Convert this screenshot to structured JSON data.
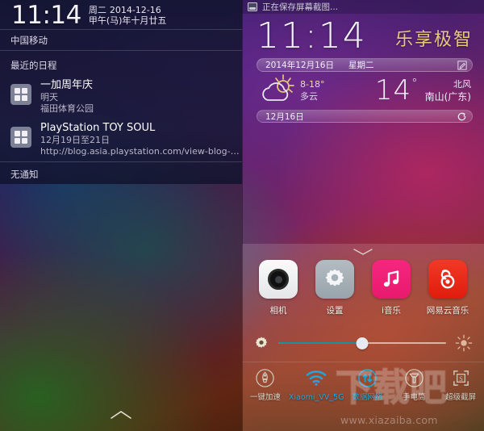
{
  "left_panel": {
    "clock": {
      "time": "11:14",
      "weekday": "周二",
      "date_iso": "2014-12-16",
      "lunar": "甲午(马)年十月廿五"
    },
    "carrier": "中国移动",
    "section_title": "最近的日程",
    "notifications": [
      {
        "icon": "calendar-grid-icon",
        "title": "一加周年庆",
        "line2": "明天",
        "line3": "福田体育公园"
      },
      {
        "icon": "calendar-grid-icon",
        "title": "PlayStation TOY SOUL",
        "line2": "12月19日至21日",
        "line3": "http://blog.asia.playstation.com/view-blog-…"
      }
    ],
    "empty_text": "无通知",
    "home_chevron": "chevron-up-icon"
  },
  "right_panel": {
    "statusbar": {
      "icon": "screenshot-saving-icon",
      "text": "正在保存屏幕截图..."
    },
    "clock_widget": {
      "time": "11:14",
      "slogan": "乐享极智",
      "date": "2014年12月16日",
      "weekday": "星期二",
      "edit_icon": "edit-pencil-icon"
    },
    "weather_widget": {
      "icon": "sun-behind-cloud-icon",
      "range": "8-18°",
      "condition": "多云",
      "temp": "14",
      "degree": "°",
      "wind": "北风",
      "location": "南山(广东)",
      "date": "12月16日",
      "refresh_icon": "refresh-icon"
    },
    "drawer": {
      "chevron": "chevron-down-icon",
      "apps": [
        {
          "label": "相机",
          "icon": "camera-icon",
          "color": "#f2f3f4"
        },
        {
          "label": "设置",
          "icon": "gear-icon",
          "color": "#a6b0b7"
        },
        {
          "label": "i音乐",
          "icon": "music-note-icon",
          "color": "#ef2074"
        },
        {
          "label": "网易云音乐",
          "icon": "netease-music-icon",
          "color": "#e72a12"
        }
      ],
      "brightness": {
        "left_icon": "gear-icon",
        "right_icon": "sun-brightness-icon",
        "value_percent": 50
      },
      "toggles": [
        {
          "label": "一键加速",
          "icon": "rocket-boost-icon",
          "state": "off"
        },
        {
          "label": "Xiaomi_VV_5G",
          "icon": "wifi-icon",
          "state": "on"
        },
        {
          "label": "数据网络",
          "icon": "mobile-data-icon",
          "state": "on"
        },
        {
          "label": "手电筒",
          "icon": "flashlight-icon",
          "state": "off"
        },
        {
          "label": "超级截屏",
          "icon": "super-screenshot-icon",
          "state": "off"
        }
      ]
    }
  },
  "watermark": {
    "text": "下载吧",
    "url": "www.xiazaiba.com"
  },
  "colors": {
    "toggle_on": "#21a6d8",
    "toggle_off": "#d8d2c6",
    "slogan": "#e8c87d",
    "slider_fill": "#1e8f9e"
  }
}
